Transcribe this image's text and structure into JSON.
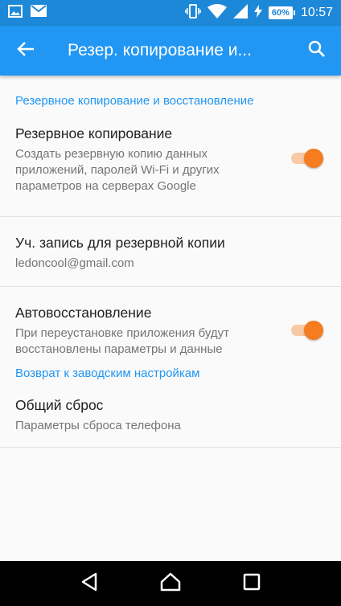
{
  "status_bar": {
    "left_icons": [
      "image-icon",
      "mail-icon"
    ],
    "right_icons": [
      "vibrate-icon",
      "wifi-icon",
      "signal-icon",
      "charging-icon"
    ],
    "battery": "60%",
    "time": "10:57"
  },
  "app_bar": {
    "title": "Резер. копирование и...",
    "back_icon": "arrow-back-icon",
    "search_icon": "search-icon",
    "color": "#2196f3"
  },
  "sections": [
    {
      "header": "Резервное копирование и восстановление",
      "items": [
        {
          "title": "Резервное копирование",
          "summary": "Создать резервную копию данных приложений, паролей Wi-Fi и других параметров на серверах Google",
          "toggle": true
        },
        {
          "title": "Уч. запись для резервной копии",
          "summary": "ledoncool@gmail.com"
        },
        {
          "title": "Автовосстановление",
          "summary": "При переустановке приложения будут восстановлены параметры и данные",
          "toggle": true
        }
      ]
    },
    {
      "header": "Возврат к заводским настройкам",
      "items": [
        {
          "title": "Общий сброс",
          "summary": "Параметры сброса телефона"
        }
      ]
    }
  ],
  "nav_bar": {
    "icons": [
      "back-triangle-icon",
      "home-icon",
      "recents-icon"
    ]
  },
  "colors": {
    "accent": "#f57c1f",
    "section_header": "#2196f3",
    "status_bar": "#1e88d8"
  }
}
